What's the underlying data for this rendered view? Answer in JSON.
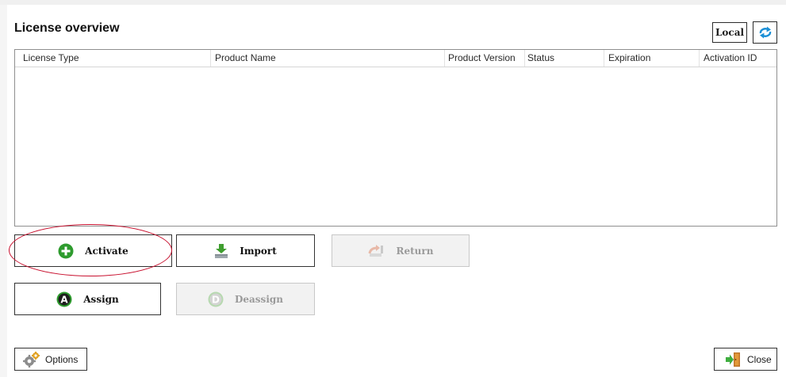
{
  "window": {
    "title": "License overview"
  },
  "toolbar": {
    "local_label": "Local",
    "refresh_icon": "refresh-arrows-icon"
  },
  "table": {
    "columns": [
      "License Type",
      "Product Name",
      "Product Version",
      "Status",
      "Expiration",
      "Activation ID"
    ],
    "rows": []
  },
  "actions": {
    "activate_label": "Activate",
    "import_label": "Import",
    "return_label": "Return",
    "assign_label": "Assign",
    "deassign_label": "Deassign"
  },
  "footer": {
    "options_label": "Options",
    "close_label": "Close"
  },
  "colors": {
    "highlight_oval": "#c8102e",
    "green_icon": "#2e9b2e",
    "disabled_text": "#9a9a9a"
  }
}
